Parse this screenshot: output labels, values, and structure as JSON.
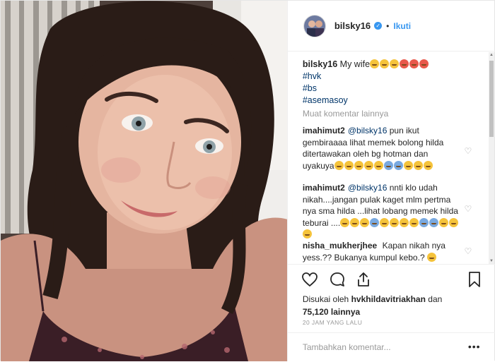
{
  "header": {
    "username": "bilsky16",
    "separator": "•",
    "follow_label": "Ikuti"
  },
  "caption": {
    "username": "bilsky16",
    "text": "My wife",
    "hashtags": [
      "#hvk",
      "#bs",
      "#asemasoy"
    ]
  },
  "load_more_label": "Muat komentar lainnya",
  "comments": [
    {
      "username": "imahimut2",
      "mention": "@bilsky16",
      "text": "pun ikut gembiraaaa lihat memek bolong hilda ditertawakan oleh bg hotman dan uyakuya"
    },
    {
      "username": "imahimut2",
      "mention": "@bilsky16",
      "text": "nnti klo udah nikah....jangan pulak kaget mlm pertma nya sma hilda ...lihat lobang memek hilda teburai ...."
    },
    {
      "username": "nisha_mukherjhee",
      "mention": "",
      "text": "Kapan nikah nya yess.?? Bukanya kumpul kebo.?"
    }
  ],
  "likes": {
    "prefix": "Disukai oleh",
    "user": "hvkhildavitriakhan",
    "connector": "dan",
    "count": "75,120 lainnya"
  },
  "timestamp": "20 JAM YANG LALU",
  "comment_input": {
    "placeholder": "Tambahkan komentar..."
  },
  "options_label": "•••",
  "icons": [
    "heart-icon",
    "comment-icon",
    "share-icon",
    "bookmark-icon",
    "verified-badge-icon",
    "heart-outline-icon"
  ],
  "colors": {
    "accent": "#3897f0",
    "hashtag": "#003569",
    "muted": "#999999"
  }
}
